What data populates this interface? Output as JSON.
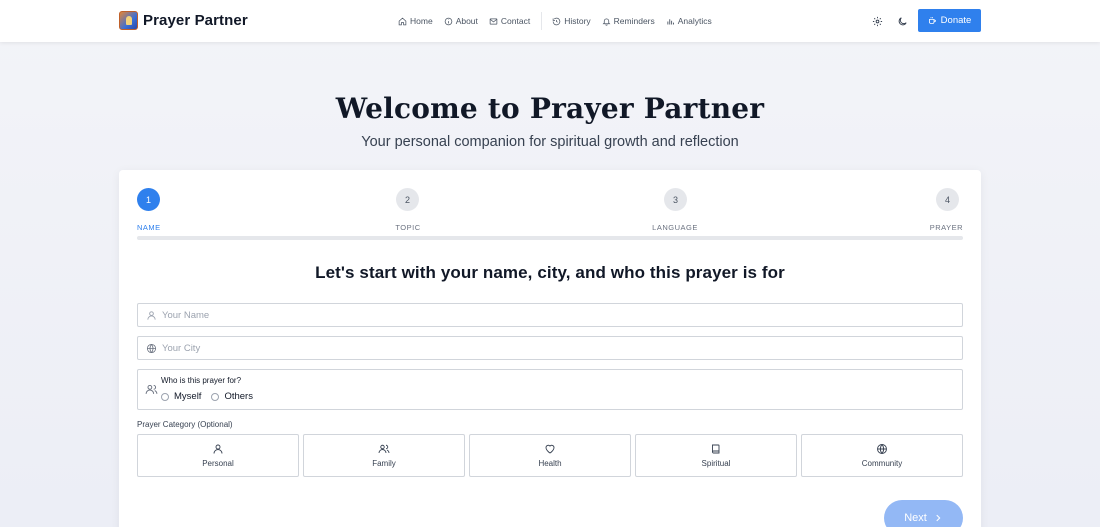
{
  "header": {
    "brand": "Prayer Partner",
    "nav": [
      {
        "label": "Home",
        "icon": "home-icon"
      },
      {
        "label": "About",
        "icon": "info-icon"
      },
      {
        "label": "Contact",
        "icon": "mail-icon"
      },
      {
        "label": "History",
        "icon": "history-icon"
      },
      {
        "label": "Reminders",
        "icon": "bell-icon"
      },
      {
        "label": "Analytics",
        "icon": "bar-chart-icon"
      }
    ],
    "settings_icon": "gear-icon",
    "theme_icon": "moon-icon",
    "donate_label": "Donate"
  },
  "hero": {
    "title": "Welcome to Prayer Partner",
    "subtitle": "Your personal companion for spiritual growth and reflection"
  },
  "steps": [
    {
      "number": "1",
      "label": "NAME",
      "active": true
    },
    {
      "number": "2",
      "label": "TOPIC",
      "active": false
    },
    {
      "number": "3",
      "label": "LANGUAGE",
      "active": false
    },
    {
      "number": "4",
      "label": "PRAYER",
      "active": false
    }
  ],
  "form": {
    "heading": "Let's start with your name, city, and who this prayer is for",
    "name_placeholder": "Your Name",
    "name_value": "",
    "city_placeholder": "Your City",
    "city_value": "",
    "who_label": "Who is this prayer for?",
    "who_options": [
      "Myself",
      "Others"
    ],
    "category_label": "Prayer Category (Optional)",
    "categories": [
      {
        "label": "Personal",
        "icon": "user-icon"
      },
      {
        "label": "Family",
        "icon": "users-icon"
      },
      {
        "label": "Health",
        "icon": "heart-icon"
      },
      {
        "label": "Spiritual",
        "icon": "book-icon"
      },
      {
        "label": "Community",
        "icon": "globe-icon"
      }
    ],
    "next_label": "Next"
  },
  "colors": {
    "accent": "#2f80ed",
    "next_disabled": "#93b8f5"
  }
}
